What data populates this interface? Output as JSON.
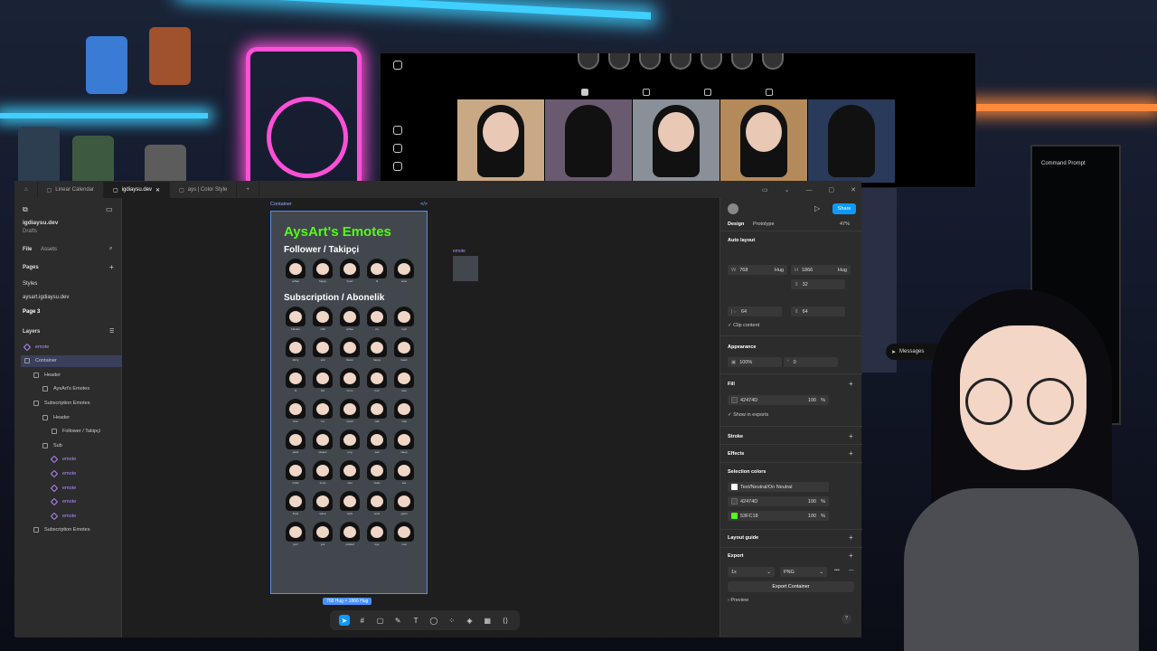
{
  "figma": {
    "tabs": [
      {
        "label": "Linear Calendar"
      },
      {
        "label": "igdiaysu.dev"
      },
      {
        "label": "ays | Color Style"
      }
    ],
    "project_title": "igdiaysu.dev",
    "project_sub": "Drafts",
    "panel_tabs": [
      "File",
      "Assets"
    ],
    "pages_heading": "Pages",
    "pages": [
      "Styles",
      "aysart.igdiaysu.dev",
      "Page 3"
    ],
    "layers_heading": "Layers",
    "layers": [
      {
        "label": "emote",
        "level": 0,
        "purple": true
      },
      {
        "label": "Container",
        "level": 0,
        "selected": true
      },
      {
        "label": "Header",
        "level": 1
      },
      {
        "label": "AysArt's Emotes",
        "level": 2
      },
      {
        "label": "Subscription Emotes",
        "level": 1
      },
      {
        "label": "Header",
        "level": 2
      },
      {
        "label": "Follower / Takipçi",
        "level": 3
      },
      {
        "label": "Sub",
        "level": 2
      },
      {
        "label": "emote",
        "level": 3,
        "purple": true
      },
      {
        "label": "emote",
        "level": 3,
        "purple": true
      },
      {
        "label": "emote",
        "level": 3,
        "purple": true
      },
      {
        "label": "emote",
        "level": 3,
        "purple": true
      },
      {
        "label": "emote",
        "level": 3,
        "purple": true
      },
      {
        "label": "Subscription Emotes",
        "level": 1
      }
    ],
    "frame_label": "Container",
    "frame_title": "AysArt's Emotes",
    "section1": "Follower / Takipçi",
    "follower_emotes": [
      "coffee",
      "happy",
      "heart",
      "hi",
      "wow"
    ],
    "section2": "Subscription / Abonelik",
    "sub_emotes": [
      "blanket",
      "chill",
      "coffee",
      "cry",
      "cry2",
      "dizzy",
      "evil",
      "flower",
      "happy",
      "heart",
      "hi",
      "hi2",
      "hmm",
      "huh",
      "kiss",
      "love",
      "lol",
      "music",
      "nail",
      "note",
      "plant",
      "please",
      "pog",
      "sad",
      "sleep",
      "smile",
      "sorry",
      "spin",
      "study",
      "tea",
      "think",
      "wave",
      "work",
      "wow",
      "yawn",
      "yum",
      "ysit",
      "ysitskul",
      "bye",
      "cool"
    ],
    "emote_tag": "emote",
    "size_badge": "768 Hug × 1866 Hug",
    "right": {
      "design_tab": "Design",
      "prototype_tab": "Prototype",
      "zoom": "47%",
      "share": "Share",
      "auto_layout": "Auto layout",
      "w_label": "W",
      "w_value": "768",
      "w_mode": "Hug",
      "h_label": "H",
      "h_value": "1866",
      "h_mode": "Hug",
      "gap_value": "32",
      "pad_h": "64",
      "pad_v": "64",
      "clip_content": "Clip content",
      "appearance": "Appearance",
      "opacity": "100%",
      "radius": "0",
      "fill": "Fill",
      "fill_hex": "42474D",
      "fill_opacity": "100",
      "fill_pct": "%",
      "show_exports": "Show in exports",
      "stroke": "Stroke",
      "effects": "Effects",
      "selection_colors": "Selection colors",
      "sel_colors": [
        {
          "name": "Text/Neutral/On Neutral",
          "hex": "#ffffff"
        },
        {
          "name": "42474D",
          "hex": "#42474d",
          "opacity": "100"
        },
        {
          "name": "53FC18",
          "hex": "#53fc18",
          "opacity": "100"
        }
      ],
      "layout_guide": "Layout guide",
      "export": "Export",
      "export_scale": "1x",
      "export_format": "PNG",
      "export_button": "Export Container",
      "preview": "Preview",
      "help": "?"
    }
  },
  "instagram": {
    "messages": "Messages"
  },
  "terminal": {
    "title": "Command Prompt"
  },
  "colors": {
    "accent": "#0d99ff",
    "green": "#53fc18",
    "frame_bg": "#42474d"
  }
}
